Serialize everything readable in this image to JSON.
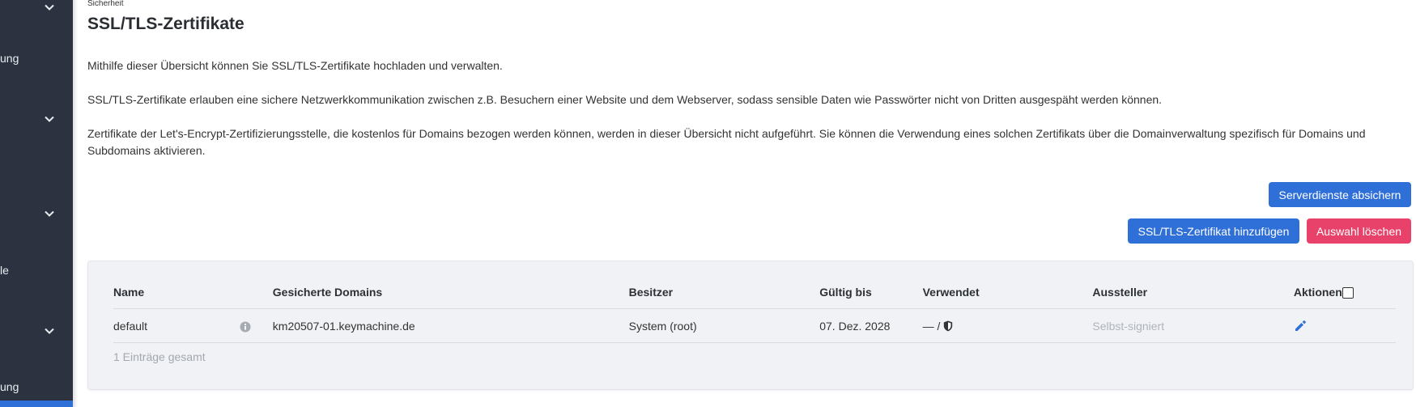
{
  "sidebar": {
    "fragments": [
      {
        "text": "ung"
      },
      {
        "text": "le"
      },
      {
        "text": "ung"
      }
    ],
    "icon_names": [
      "chevron-down-icon"
    ]
  },
  "breadcrumb": "Sicherheit",
  "page_title": "SSL/TLS-Zertifikate",
  "paragraphs": [
    "Mithilfe dieser Übersicht können Sie SSL/TLS-Zertifikate hochladen und verwalten.",
    "SSL/TLS-Zertifikate erlauben eine sichere Netzwerkkommunikation zwischen z.B. Besuchern einer Website und dem Webserver, sodass sensible Daten wie Passwörter nicht von Dritten ausgespäht werden können.",
    "Zertifikate der Let's-Encrypt-Zertifizierungsstelle, die kostenlos für Domains bezogen werden können, werden in dieser Übersicht nicht aufgeführt. Sie können die Verwendung eines solchen Zertifikats über die Domainverwaltung spezifisch für Domains und Subdomains aktivieren."
  ],
  "buttons": {
    "secure_services": "Serverdienste absichern",
    "add_certificate": "SSL/TLS-Zertifikat hinzufügen",
    "delete_selection": "Auswahl löschen"
  },
  "table": {
    "columns": [
      "Name",
      "Gesicherte Domains",
      "Besitzer",
      "Gültig bis",
      "Verwendet",
      "Aussteller",
      "Aktionen"
    ],
    "rows": [
      {
        "name": "default",
        "domains": "km20507-01.keymachine.de",
        "owner": "System (root)",
        "valid_until": "07. Dez. 2028",
        "used": "— /",
        "issuer": "Selbst-signiert"
      }
    ],
    "footer": "1 Einträge gesamt"
  },
  "colors": {
    "sidebar_bg": "#2c3240",
    "primary": "#2f6fd8",
    "danger": "#e8426b",
    "panel_bg": "#f0f2f6"
  },
  "icons": [
    "chevron-down-icon",
    "info-icon",
    "shield-icon",
    "edit-icon"
  ]
}
